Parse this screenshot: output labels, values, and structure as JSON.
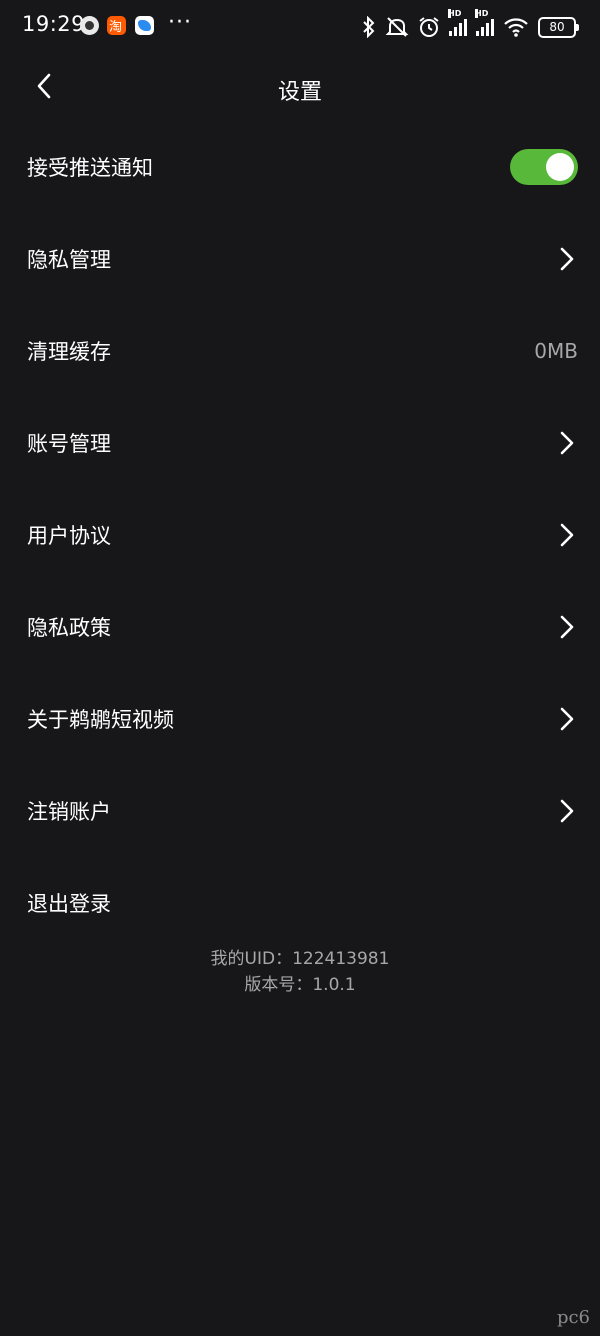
{
  "status_bar": {
    "time": "19:29",
    "battery": "80",
    "hd1": "HD",
    "hd2": "HD",
    "icons": [
      "app-icon",
      "taobao-icon",
      "app-bird-icon",
      "bluetooth-icon",
      "mute-icon",
      "alarm-icon",
      "signal-icon",
      "signal-icon",
      "wifi-icon",
      "battery-icon"
    ]
  },
  "header": {
    "title": "设置"
  },
  "settings": {
    "push": {
      "label": "接受推送通知",
      "enabled": true
    },
    "privacy_manage": {
      "label": "隐私管理"
    },
    "cache": {
      "label": "清理缓存",
      "value": "0MB"
    },
    "account_manage": {
      "label": "账号管理"
    },
    "user_agreement": {
      "label": "用户协议"
    },
    "privacy_policy": {
      "label": "隐私政策"
    },
    "about": {
      "label": "关于鹈鹕短视频"
    },
    "delete_account": {
      "label": "注销账户"
    },
    "logout": {
      "label": "退出登录"
    }
  },
  "footer": {
    "uid": "我的UID：122413981",
    "version": "版本号：1.0.1"
  },
  "watermark": "pc6",
  "colors": {
    "background": "#171719",
    "toggle_on": "#57b83a",
    "secondary_text": "#a7a7a7"
  }
}
